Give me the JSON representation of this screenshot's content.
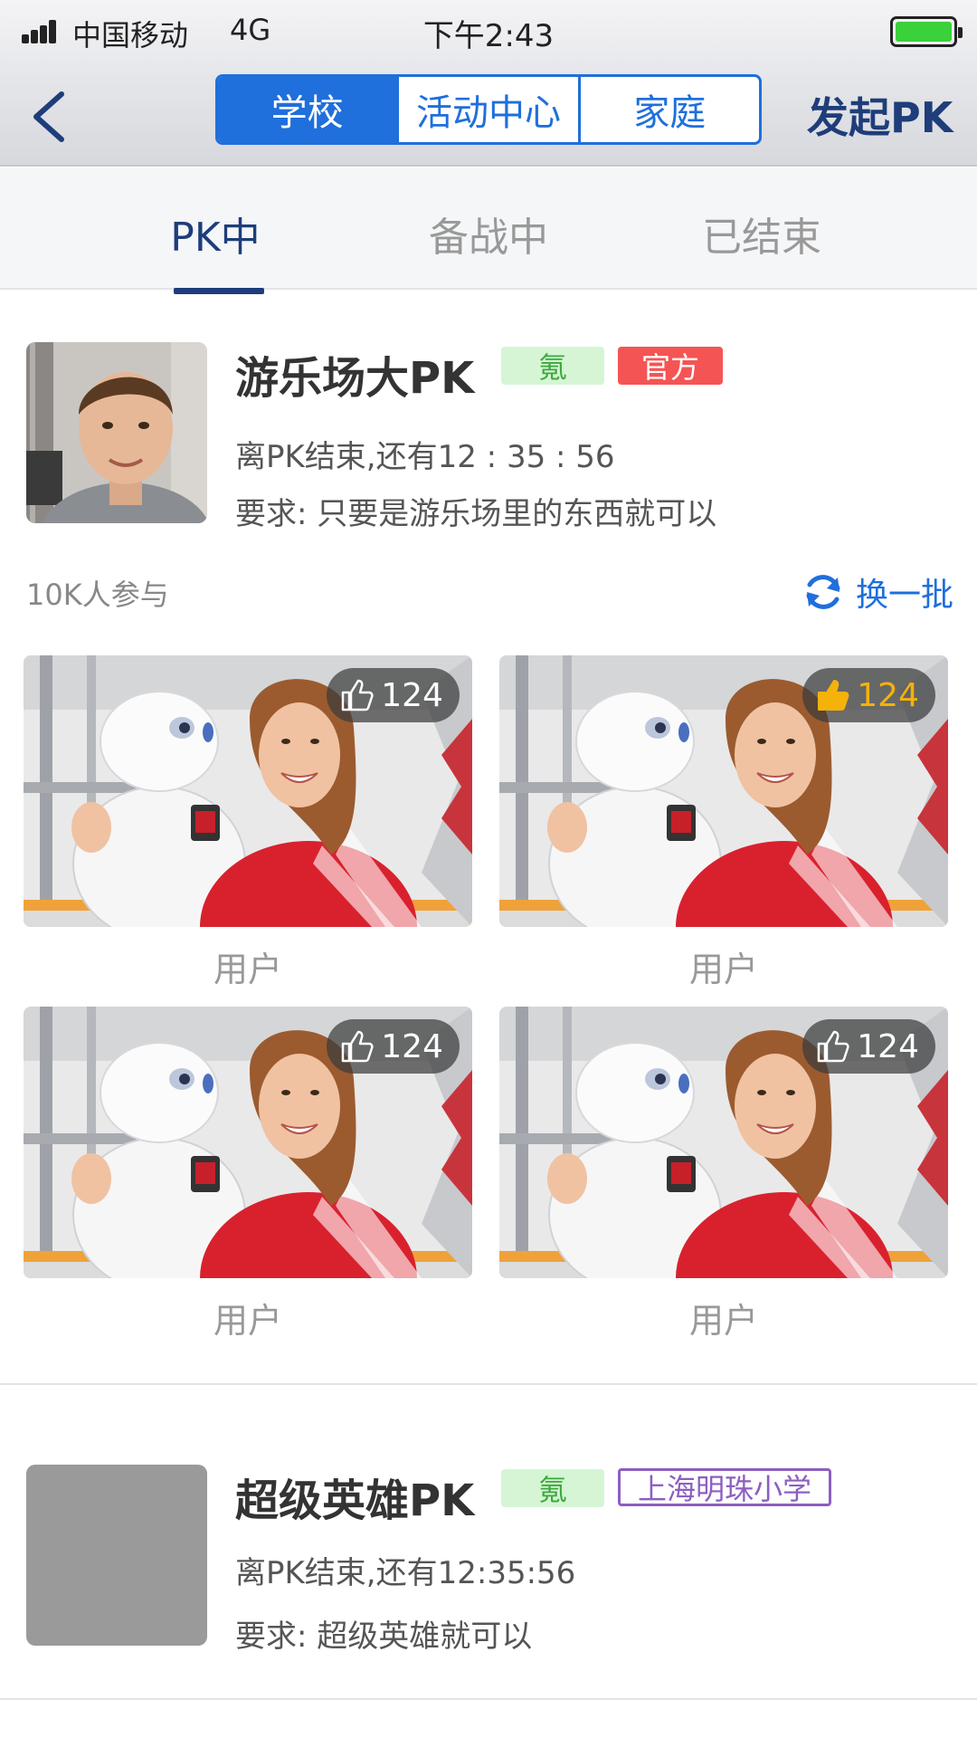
{
  "status_bar": {
    "carrier": "中国移动",
    "network": "4G",
    "time": "下午2:43"
  },
  "nav": {
    "segments": [
      {
        "label": "学校",
        "active": true
      },
      {
        "label": "活动中心",
        "active": false
      },
      {
        "label": "家庭",
        "active": false
      }
    ],
    "action": "发起PK"
  },
  "tabs": [
    {
      "label": "PK中",
      "active": true
    },
    {
      "label": "备战中",
      "active": false
    },
    {
      "label": "已结束",
      "active": false
    }
  ],
  "card1": {
    "title": "游乐场大PK",
    "badge_tag": "氪",
    "badge_org": "官方",
    "countdown": "离PK结束,还有12 : 35 : 56",
    "requirement": "要求: 只要是游乐场里的东西就可以",
    "participants": "10K人参与",
    "refresh": "换一批",
    "entries": [
      {
        "likes": "124",
        "liked": false,
        "user": "用户"
      },
      {
        "likes": "124",
        "liked": true,
        "user": "用户"
      },
      {
        "likes": "124",
        "liked": false,
        "user": "用户"
      },
      {
        "likes": "124",
        "liked": false,
        "user": "用户"
      }
    ]
  },
  "card2": {
    "title": "超级英雄PK",
    "badge_tag": "氪",
    "badge_org": "上海明珠小学",
    "countdown": "离PK结束,还有12:35:56",
    "requirement": "要求: 超级英雄就可以"
  },
  "colors": {
    "accent": "#1f6fdc",
    "navy": "#1e3d7a",
    "liked": "#f4b20a",
    "official": "#f55454",
    "school": "#8c5fc0"
  }
}
